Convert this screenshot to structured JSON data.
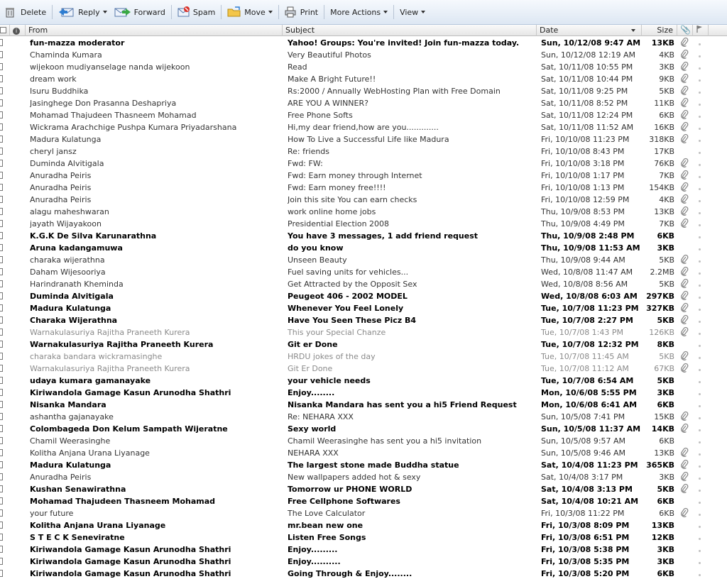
{
  "toolbar": {
    "delete": "Delete",
    "reply": "Reply",
    "forward": "Forward",
    "spam": "Spam",
    "move": "Move",
    "print": "Print",
    "more_actions": "More Actions",
    "view": "View"
  },
  "columns": {
    "from": "From",
    "subject": "Subject",
    "date": "Date",
    "size": "Size"
  },
  "messages": [
    {
      "from": "fun-mazza moderator",
      "subject": "Yahoo! Groups: You're invited! Join fun-mazza today.",
      "date": "Sun, 10/12/08 9:47 AM",
      "size": "13KB",
      "unread": true,
      "attach": true
    },
    {
      "from": "Chaminda Kumara",
      "subject": "Very Beautiful Photos",
      "date": "Sun, 10/12/08 12:19 AM",
      "size": "4KB",
      "unread": false,
      "attach": true
    },
    {
      "from": "wijekoon mudiyanselage nanda wijekoon",
      "subject": "Read",
      "date": "Sat, 10/11/08 10:55 PM",
      "size": "3KB",
      "unread": false,
      "attach": true
    },
    {
      "from": "dream work",
      "subject": "Make A Bright Future!!",
      "date": "Sat, 10/11/08 10:44 PM",
      "size": "9KB",
      "unread": false,
      "attach": true
    },
    {
      "from": "Isuru Buddhika",
      "subject": "Rs:2000 / Annually WebHosting Plan with Free Domain",
      "date": "Sat, 10/11/08 9:25 PM",
      "size": "5KB",
      "unread": false,
      "attach": true
    },
    {
      "from": "Jasinghege Don Prasanna Deshapriya",
      "subject": "ARE YOU A WINNER?",
      "date": "Sat, 10/11/08 8:52 PM",
      "size": "11KB",
      "unread": false,
      "attach": true
    },
    {
      "from": "Mohamad Thajudeen Thasneem Mohamad",
      "subject": "Free Phone Softs",
      "date": "Sat, 10/11/08 12:24 PM",
      "size": "6KB",
      "unread": false,
      "attach": true
    },
    {
      "from": "Wickrama Arachchige Pushpa Kumara Priyadarshana",
      "subject": "Hi,my dear friend,how are you.............",
      "date": "Sat, 10/11/08 11:52 AM",
      "size": "16KB",
      "unread": false,
      "attach": true
    },
    {
      "from": "Madura Kulatunga",
      "subject": "How To Live a Successful Life like Madura",
      "date": "Fri, 10/10/08 11:23 PM",
      "size": "318KB",
      "unread": false,
      "attach": true
    },
    {
      "from": "cheryl jansz",
      "subject": "Re: friends",
      "date": "Fri, 10/10/08 8:43 PM",
      "size": "17KB",
      "unread": false,
      "attach": false
    },
    {
      "from": "Duminda Alvitigala",
      "subject": "Fwd: FW:",
      "date": "Fri, 10/10/08 3:18 PM",
      "size": "76KB",
      "unread": false,
      "attach": true
    },
    {
      "from": "Anuradha Peiris",
      "subject": "Fwd: Earn money through Internet",
      "date": "Fri, 10/10/08 1:17 PM",
      "size": "7KB",
      "unread": false,
      "attach": true
    },
    {
      "from": "Anuradha Peiris",
      "subject": "Fwd: Earn money free!!!!",
      "date": "Fri, 10/10/08 1:13 PM",
      "size": "154KB",
      "unread": false,
      "attach": true
    },
    {
      "from": "Anuradha Peiris",
      "subject": "Join this site You can earn checks",
      "date": "Fri, 10/10/08 12:59 PM",
      "size": "4KB",
      "unread": false,
      "attach": true
    },
    {
      "from": "alagu maheshwaran",
      "subject": "work online home jobs",
      "date": "Thu, 10/9/08 8:53 PM",
      "size": "13KB",
      "unread": false,
      "attach": true
    },
    {
      "from": "jayath Wijayakoon",
      "subject": "Presidential Election 2008",
      "date": "Thu, 10/9/08 4:49 PM",
      "size": "7KB",
      "unread": false,
      "attach": true
    },
    {
      "from": "K.G.K De Silva Karunarathna",
      "subject": "You have 3 messages, 1 add friend request",
      "date": "Thu, 10/9/08 2:48 PM",
      "size": "6KB",
      "unread": true,
      "attach": false
    },
    {
      "from": "Aruna kadangamuwa",
      "subject": "do you know",
      "date": "Thu, 10/9/08 11:53 AM",
      "size": "3KB",
      "unread": true,
      "attach": false
    },
    {
      "from": "charaka wijerathna",
      "subject": "Unseen Beauty",
      "date": "Thu, 10/9/08 9:44 AM",
      "size": "5KB",
      "unread": false,
      "attach": true
    },
    {
      "from": "Daham Wijesooriya",
      "subject": "Fuel saving units for vehicles...",
      "date": "Wed, 10/8/08 11:47 AM",
      "size": "2.2MB",
      "unread": false,
      "attach": true
    },
    {
      "from": "Harindranath Kheminda",
      "subject": "Get Attracted by the Opposit Sex",
      "date": "Wed, 10/8/08 8:56 AM",
      "size": "5KB",
      "unread": false,
      "attach": true
    },
    {
      "from": "Duminda Alvitigala",
      "subject": "Peugeot 406 - 2002 MODEL",
      "date": "Wed, 10/8/08 6:03 AM",
      "size": "297KB",
      "unread": true,
      "attach": true
    },
    {
      "from": "Madura Kulatunga",
      "subject": "Whenever You Feel Lonely",
      "date": "Tue, 10/7/08 11:23 PM",
      "size": "327KB",
      "unread": true,
      "attach": true
    },
    {
      "from": "Charaka Wijerathna",
      "subject": "Have You Seen These Picz B4",
      "date": "Tue, 10/7/08 2:27 PM",
      "size": "5KB",
      "unread": true,
      "attach": true
    },
    {
      "from": "Warnakulasuriya Rajitha Praneeth Kurera",
      "subject": "This your Special Chanze",
      "date": "Tue, 10/7/08 1:43 PM",
      "size": "126KB",
      "unread": false,
      "attach": true,
      "faded": true
    },
    {
      "from": "Warnakulasuriya Rajitha Praneeth Kurera",
      "subject": "Git er Done",
      "date": "Tue, 10/7/08 12:32 PM",
      "size": "8KB",
      "unread": true,
      "attach": false
    },
    {
      "from": "charaka bandara wickramasinghe",
      "subject": "HRDU jokes of the day",
      "date": "Tue, 10/7/08 11:45 AM",
      "size": "5KB",
      "unread": false,
      "attach": true,
      "faded": true
    },
    {
      "from": "Warnakulasuriya Rajitha Praneeth Kurera",
      "subject": "Git Er Done",
      "date": "Tue, 10/7/08 11:12 AM",
      "size": "67KB",
      "unread": false,
      "attach": true,
      "faded": true
    },
    {
      "from": "udaya kumara gamanayake",
      "subject": "your vehicle needs",
      "date": "Tue, 10/7/08 6:54 AM",
      "size": "5KB",
      "unread": true,
      "attach": false
    },
    {
      "from": "Kiriwandola Gamage Kasun Arunodha Shathri",
      "subject": "Enjoy........",
      "date": "Mon, 10/6/08 5:55 PM",
      "size": "3KB",
      "unread": true,
      "attach": false
    },
    {
      "from": "Nisanka Mandara",
      "subject": "Nisanka Mandara has sent you a hi5 Friend Request",
      "date": "Mon, 10/6/08 6:41 AM",
      "size": "6KB",
      "unread": true,
      "attach": false
    },
    {
      "from": "ashantha gajanayake",
      "subject": "Re: NEHARA XXX",
      "date": "Sun, 10/5/08 7:41 PM",
      "size": "15KB",
      "unread": false,
      "attach": true
    },
    {
      "from": "Colombageda Don Kelum Sampath Wijeratne",
      "subject": "Sexy world",
      "date": "Sun, 10/5/08 11:37 AM",
      "size": "14KB",
      "unread": true,
      "attach": true
    },
    {
      "from": "Chamil Weerasinghe",
      "subject": "Chamil Weerasinghe has sent you a hi5 invitation",
      "date": "Sun, 10/5/08 9:57 AM",
      "size": "6KB",
      "unread": false,
      "attach": false
    },
    {
      "from": "Kolitha Anjana Urana Liyanage",
      "subject": "NEHARA XXX",
      "date": "Sun, 10/5/08 9:46 AM",
      "size": "13KB",
      "unread": false,
      "attach": true
    },
    {
      "from": "Madura Kulatunga",
      "subject": "The largest stone made Buddha statue",
      "date": "Sat, 10/4/08 11:23 PM",
      "size": "365KB",
      "unread": true,
      "attach": true
    },
    {
      "from": "Anuradha Peiris",
      "subject": "New wallpapers added hot & sexy",
      "date": "Sat, 10/4/08 3:17 PM",
      "size": "3KB",
      "unread": false,
      "attach": true
    },
    {
      "from": "Kushan Senawirathna",
      "subject": "Tomorrow ur PHONE WORLD",
      "date": "Sat, 10/4/08 3:13 PM",
      "size": "5KB",
      "unread": true,
      "attach": true
    },
    {
      "from": "Mohamad Thajudeen Thasneem Mohamad",
      "subject": "Free Cellphone Softwares",
      "date": "Sat, 10/4/08 10:21 AM",
      "size": "6KB",
      "unread": true,
      "attach": false
    },
    {
      "from": "your future",
      "subject": "The Love Calculator",
      "date": "Fri, 10/3/08 11:22 PM",
      "size": "6KB",
      "unread": false,
      "attach": true
    },
    {
      "from": "Kolitha Anjana Urana Liyanage",
      "subject": "mr.bean new one",
      "date": "Fri, 10/3/08 8:09 PM",
      "size": "13KB",
      "unread": true,
      "attach": false
    },
    {
      "from": "S T E C K Seneviratne",
      "subject": "Listen Free Songs",
      "date": "Fri, 10/3/08 6:51 PM",
      "size": "12KB",
      "unread": true,
      "attach": false
    },
    {
      "from": "Kiriwandola Gamage Kasun Arunodha Shathri",
      "subject": "Enjoy.........",
      "date": "Fri, 10/3/08 5:38 PM",
      "size": "3KB",
      "unread": true,
      "attach": false
    },
    {
      "from": "Kiriwandola Gamage Kasun Arunodha Shathri",
      "subject": "Enjoy..........",
      "date": "Fri, 10/3/08 5:35 PM",
      "size": "3KB",
      "unread": true,
      "attach": false
    },
    {
      "from": "Kiriwandola Gamage Kasun Arunodha Shathri",
      "subject": "Going Through & Enjoy........",
      "date": "Fri, 10/3/08 5:20 PM",
      "size": "6KB",
      "unread": true,
      "attach": false
    }
  ]
}
